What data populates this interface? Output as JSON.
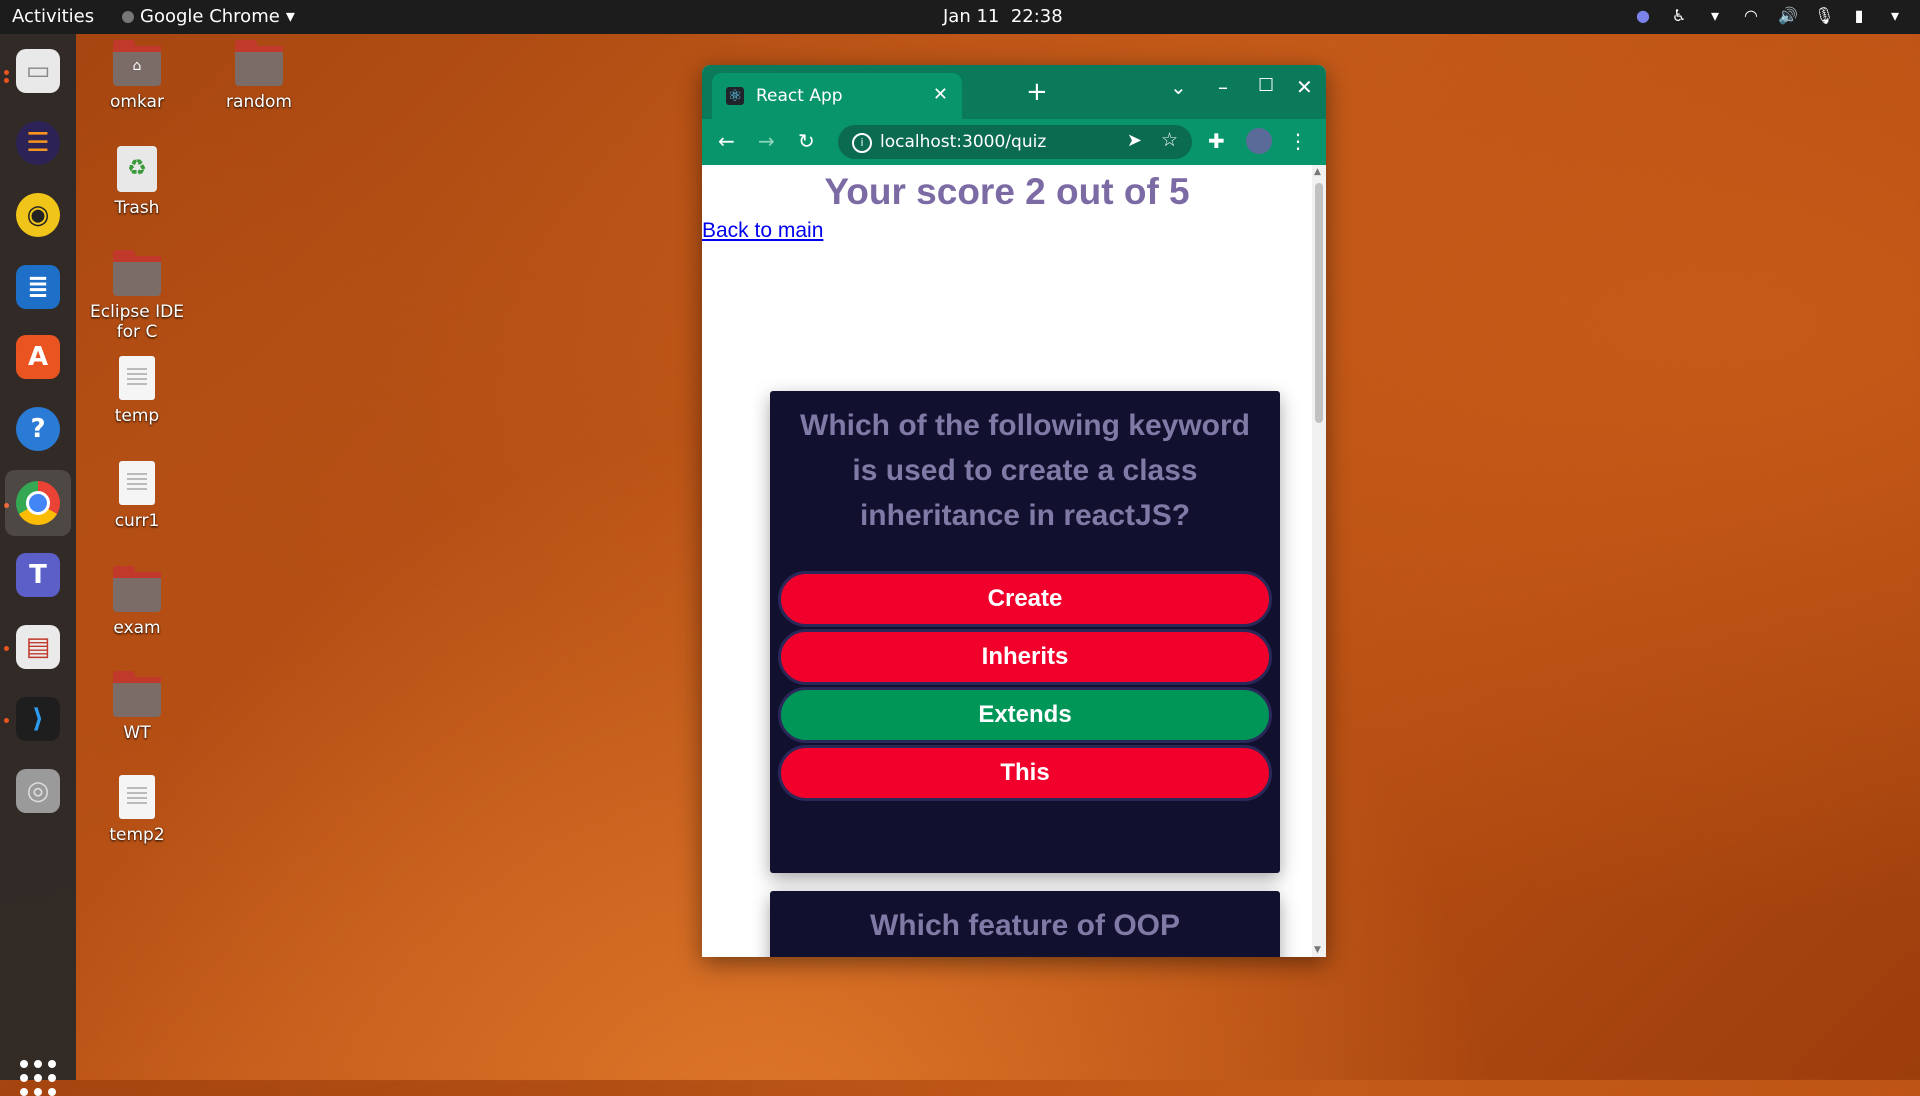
{
  "topbar": {
    "activities": "Activities",
    "app_name": "Google Chrome",
    "date": "Jan 11",
    "time": "22:38"
  },
  "desktop_icons": {
    "omkar": "omkar",
    "random": "random",
    "trash": "Trash",
    "eclipse": "Eclipse IDE for C",
    "temp": "temp",
    "curr1": "curr1",
    "exam": "exam",
    "wt": "WT",
    "temp2": "temp2"
  },
  "browser": {
    "tab_title": "React App",
    "url": "localhost:3000/quiz"
  },
  "page": {
    "score_text": "Your score 2 out of 5",
    "back_link": "Back to main",
    "question1": {
      "text": "Which of the following keyword is used to create a class inheritance in reactJS?",
      "options": [
        {
          "label": "Create",
          "color": "#f0002a"
        },
        {
          "label": "Inherits",
          "color": "#f0002a"
        },
        {
          "label": "Extends",
          "color": "#009658"
        },
        {
          "label": "This",
          "color": "#f0002a"
        }
      ]
    },
    "question2": {
      "text": "Which feature of OOP"
    }
  },
  "colors": {
    "wrong": "#f0002a",
    "correct": "#009658",
    "card_bg": "#11102e",
    "chrome_theme": "#09956b"
  }
}
